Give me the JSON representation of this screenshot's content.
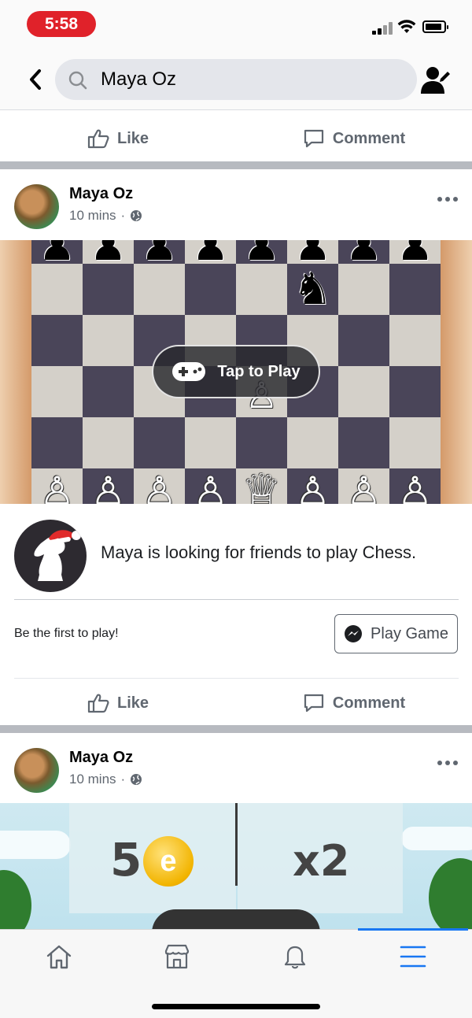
{
  "status_bar": {
    "time": "5:58",
    "time_pill_color": "#e0222a"
  },
  "header": {
    "search_value": "Maya Oz",
    "icons": [
      "chevron-left-icon",
      "search-icon",
      "person-edit-icon"
    ]
  },
  "top_actions": {
    "like": "Like",
    "comment": "Comment"
  },
  "post1": {
    "author": "Maya Oz",
    "time": "10 mins",
    "separator": "·",
    "tap_to_play": "Tap to Play",
    "game_description": "Maya is looking for friends to play Chess.",
    "first_to_play": "Be the first to play!",
    "play_button": "Play Game",
    "actions": {
      "like": "Like",
      "comment": "Comment"
    }
  },
  "post2": {
    "author": "Maya Oz",
    "time": "10 mins",
    "separator": "·",
    "coin_amount": "5",
    "coin_letter": "e",
    "multiplier": "x2"
  },
  "tab_bar": {
    "tabs": [
      "home-icon",
      "marketplace-icon",
      "notifications-icon",
      "menu-icon"
    ],
    "active_index": 3,
    "active_color": "#1877f2"
  }
}
